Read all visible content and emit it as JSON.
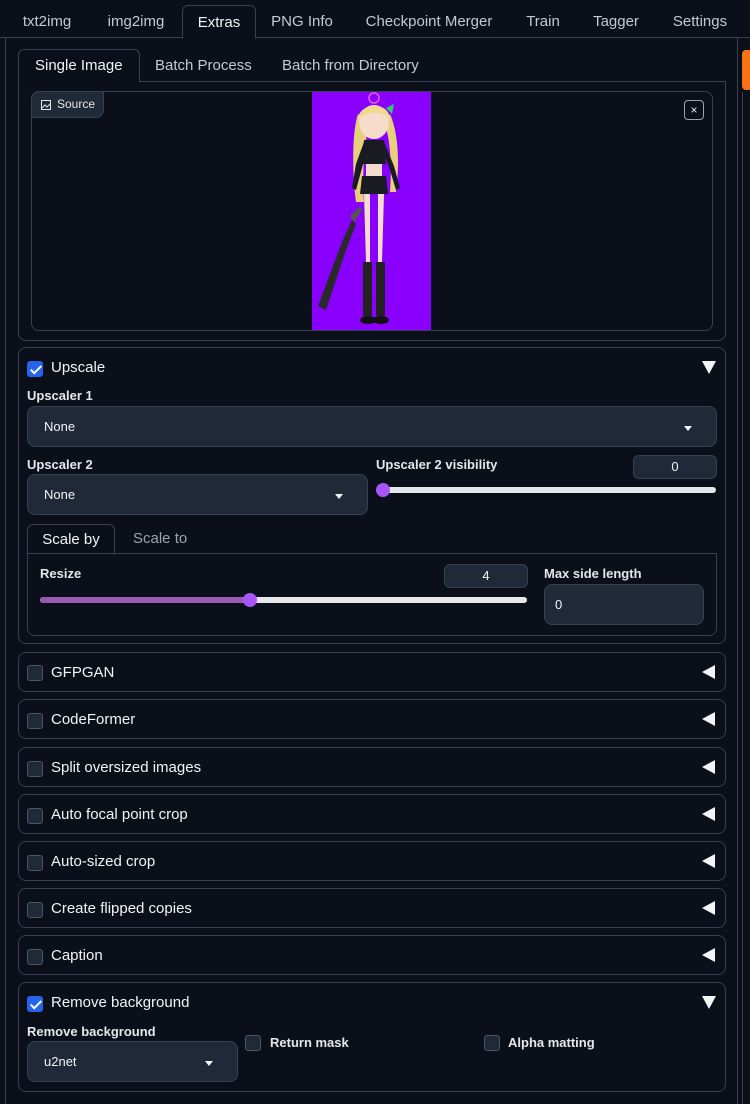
{
  "top_tabs": [
    "txt2img",
    "img2img",
    "Extras",
    "PNG Info",
    "Checkpoint Merger",
    "Train",
    "Tagger",
    "Settings"
  ],
  "sub_tabs": [
    "Single Image",
    "Batch Process",
    "Batch from Directory"
  ],
  "source": {
    "label": "Source",
    "close": "×"
  },
  "upscale": {
    "title": "Upscale",
    "enabled": true,
    "upscaler1_label": "Upscaler 1",
    "upscaler1_value": "None",
    "upscaler2_label": "Upscaler 2",
    "upscaler2_value": "None",
    "visibility_label": "Upscaler 2 visibility",
    "visibility_value": "0",
    "scale_tabs": [
      "Scale by",
      "Scale to"
    ],
    "resize_label": "Resize",
    "resize_value": "4",
    "max_side_label": "Max side length",
    "max_side_value": "0"
  },
  "collapsed_sections": [
    "GFPGAN",
    "CodeFormer",
    "Split oversized images",
    "Auto focal point crop",
    "Auto-sized crop",
    "Create flipped copies",
    "Caption"
  ],
  "remove_bg": {
    "title": "Remove background",
    "enabled": true,
    "model_label": "Remove background",
    "model_value": "u2net",
    "return_mask": "Return mask",
    "alpha_matting": "Alpha matting"
  }
}
